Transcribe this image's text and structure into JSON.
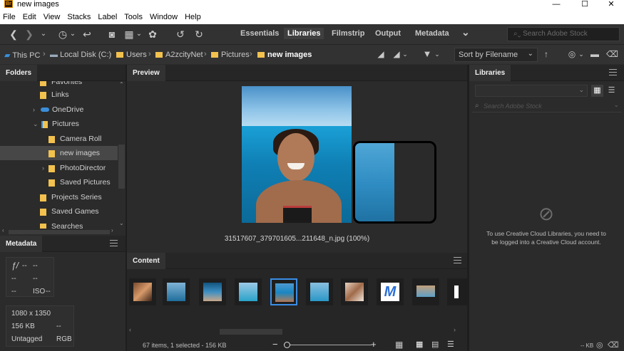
{
  "window": {
    "title": "new images",
    "app_icon": "Br",
    "minimize": "—",
    "maximize": "☐",
    "close": "✕"
  },
  "menu": [
    "File",
    "Edit",
    "View",
    "Stacks",
    "Label",
    "Tools",
    "Window",
    "Help"
  ],
  "workspaces": {
    "essentials": "Essentials",
    "libraries": "Libraries",
    "filmstrip": "Filmstrip",
    "output": "Output",
    "metadata": "Metadata",
    "more": "⌄"
  },
  "search": {
    "placeholder": "Search Adobe Stock"
  },
  "path": {
    "crumbs": [
      "This PC",
      "Local Disk (C:)",
      "Users",
      "A2zcityNet",
      "Pictures",
      "new images"
    ],
    "separator": "›"
  },
  "sort": {
    "label": "Sort by Filename"
  },
  "folders": {
    "title": "Folders",
    "items": [
      {
        "label": "Favorites"
      },
      {
        "label": "Links"
      },
      {
        "label": "OneDrive"
      },
      {
        "label": "Pictures"
      },
      {
        "label": "Camera Roll"
      },
      {
        "label": "new images"
      },
      {
        "label": "PhotoDirector"
      },
      {
        "label": "Saved Pictures"
      },
      {
        "label": "Projects Series"
      },
      {
        "label": "Saved Games"
      },
      {
        "label": "Searches"
      }
    ]
  },
  "metadata": {
    "title": "Metadata",
    "fstop": "ƒ/",
    "fstop_val": "--",
    "shutter": "--",
    "exposure": "--",
    "focal": "--",
    "iso_dash": "--",
    "iso_label": "ISO",
    "iso_val": "--",
    "dimensions": "1080 x 1350",
    "size": "156 KB",
    "size_extra": "--",
    "tag": "Untagged",
    "color_mode": "RGB"
  },
  "preview": {
    "title": "Preview",
    "caption": "31517607_379701605...211648_n.jpg (100%)"
  },
  "content": {
    "title": "Content",
    "status": "67 items, 1 selected - 156 KB"
  },
  "libraries": {
    "title": "Libraries",
    "search_placeholder": "Search Adobe Stock",
    "message": "To use Creative Cloud Libraries, you need to be logged into a Creative Cloud account.",
    "kb_label": "-- KB"
  },
  "colors": {
    "folder": "#f2c14e",
    "selection": "#3a8ee6",
    "bg": "#2b2b2b"
  }
}
